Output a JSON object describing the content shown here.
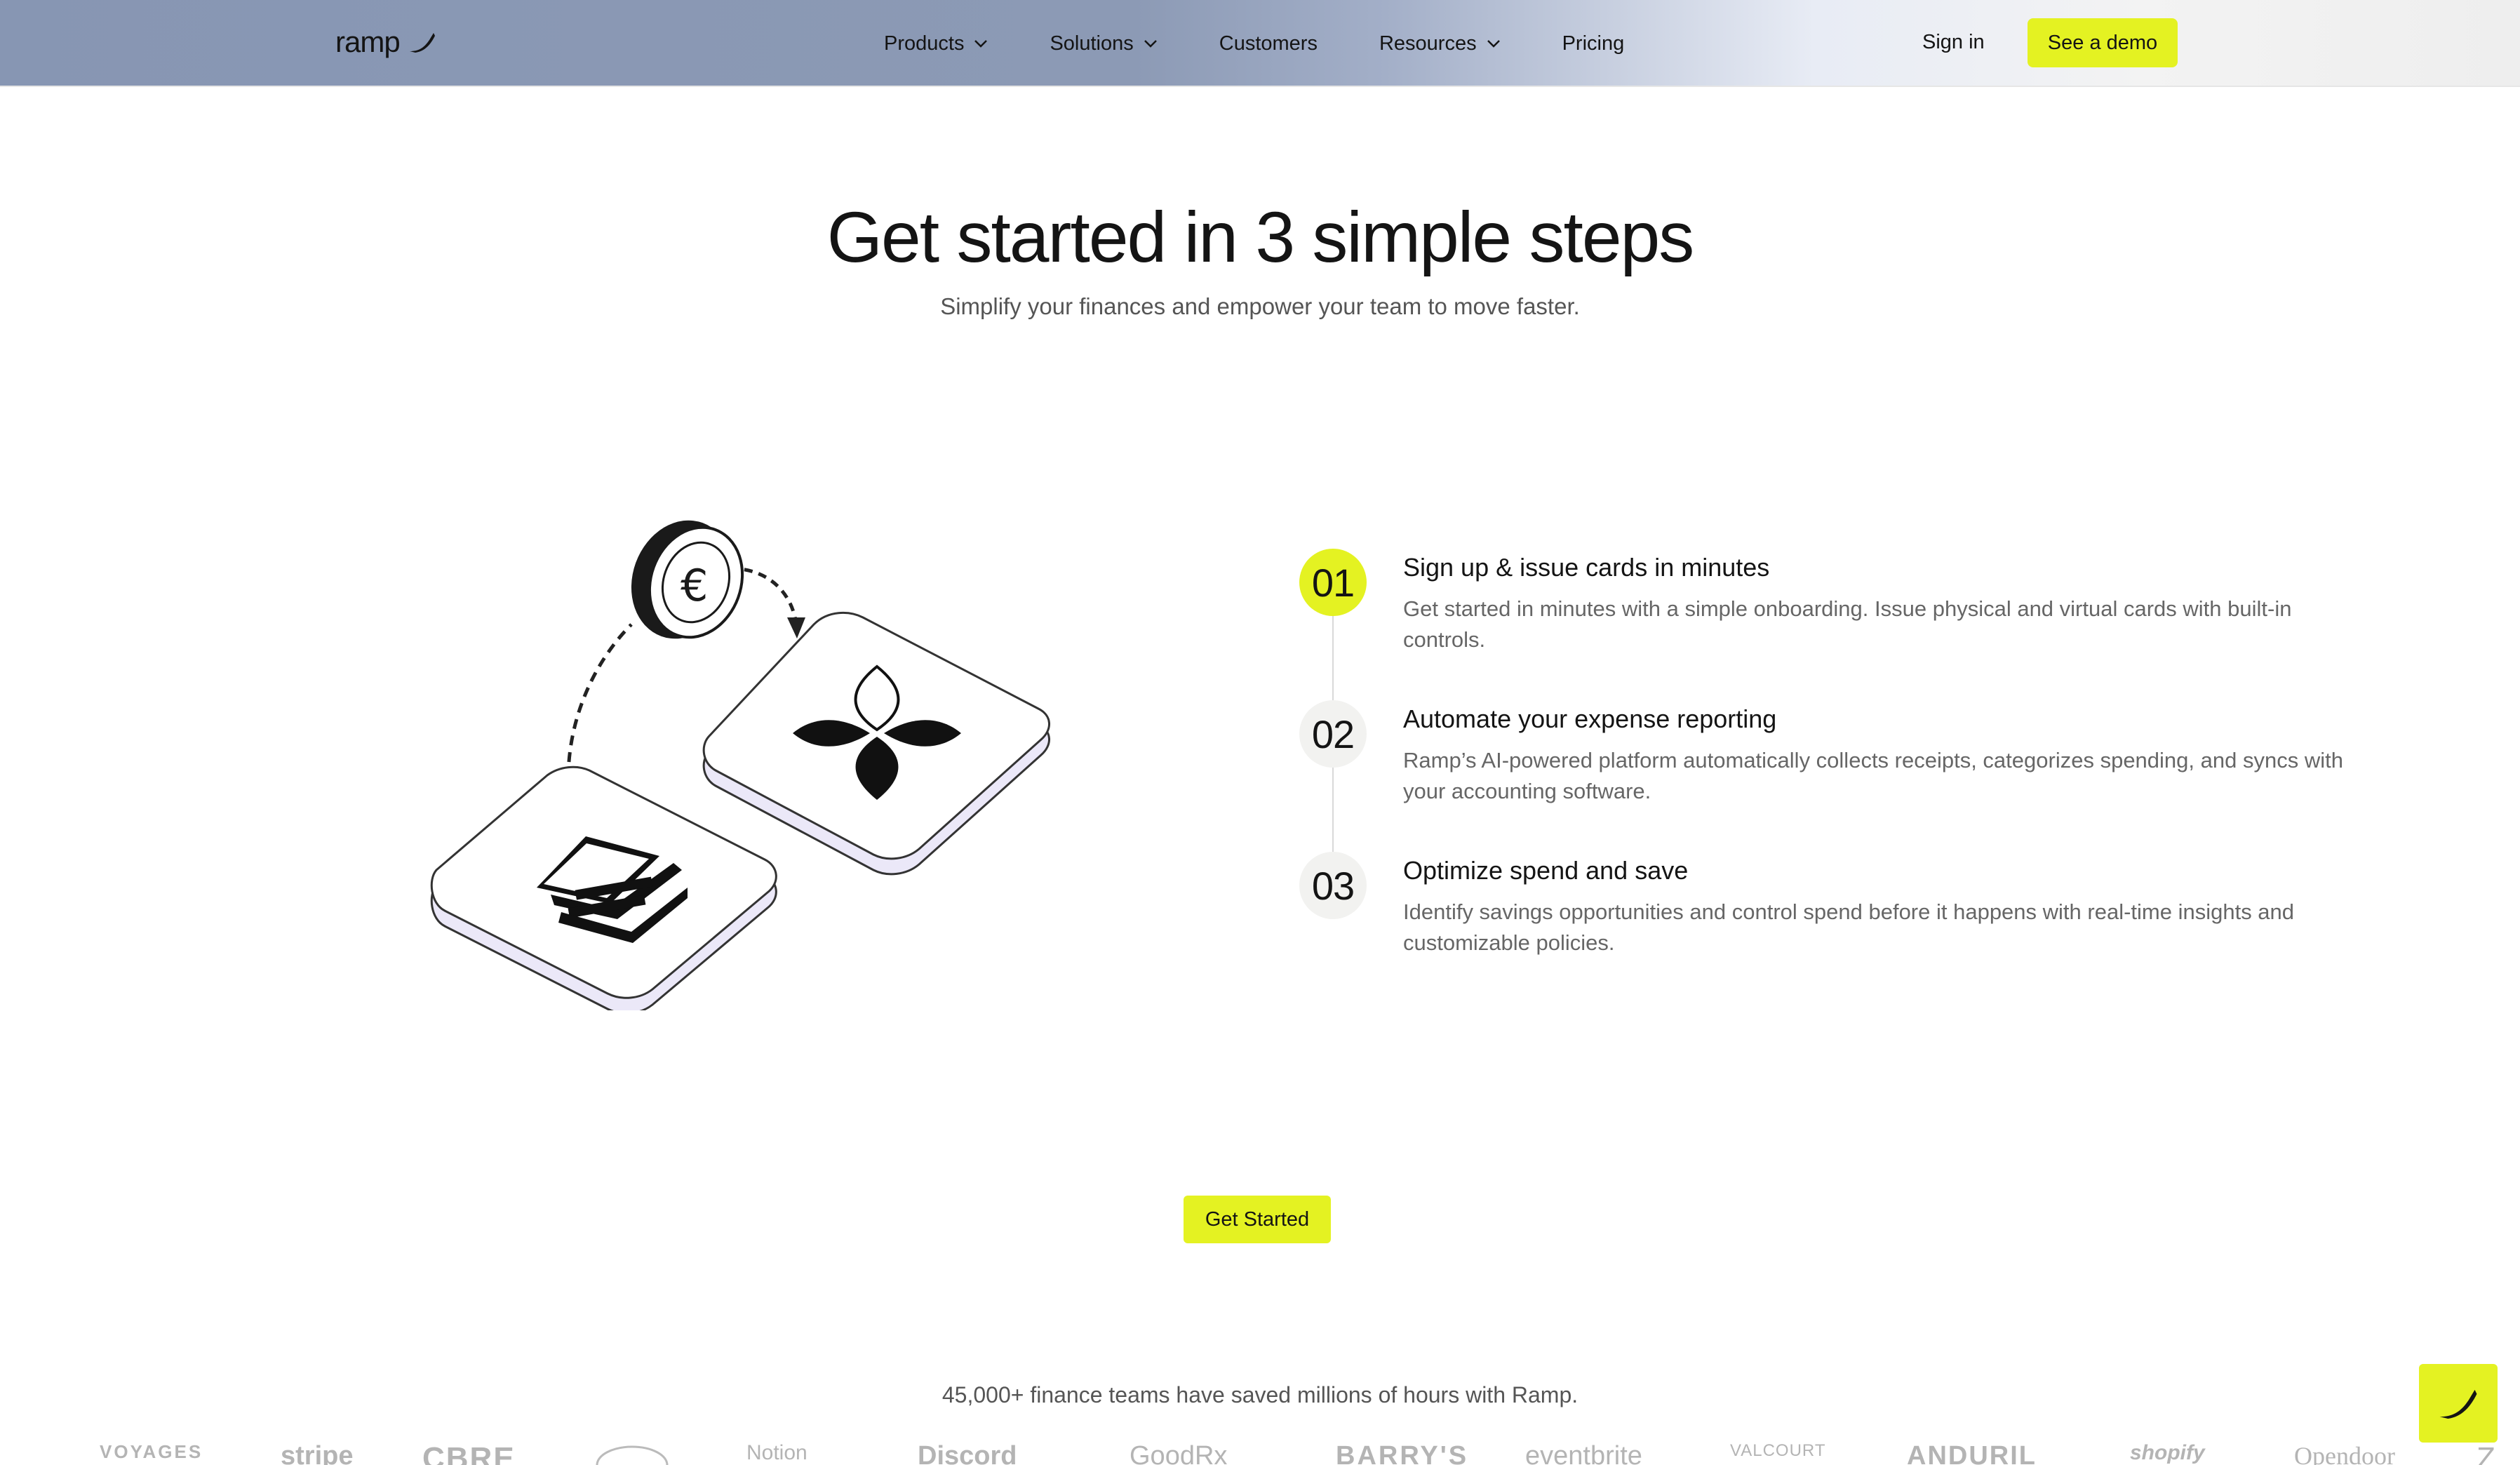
{
  "nav": {
    "logo_text": "ramp",
    "items": [
      {
        "label": "Products",
        "dropdown": true
      },
      {
        "label": "Solutions",
        "dropdown": true
      },
      {
        "label": "Customers",
        "dropdown": false
      },
      {
        "label": "Resources",
        "dropdown": true
      },
      {
        "label": "Pricing",
        "dropdown": false
      }
    ],
    "sign_in": "Sign in",
    "demo": "See a demo"
  },
  "hero": {
    "title": "Get started in 3 simple steps",
    "subtitle": "Simplify your finances and empower your team to move faster."
  },
  "steps": [
    {
      "num": "01",
      "title": "Sign up & issue cards in minutes",
      "desc": "Get started in minutes with a simple onboarding. Issue physical and virtual cards with built-in controls."
    },
    {
      "num": "02",
      "title": "Automate your expense reporting",
      "desc": "Ramp’s AI-powered platform automatically collects receipts, categorizes spending, and syncs with your accounting software."
    },
    {
      "num": "03",
      "title": "Optimize spend and save",
      "desc": "Identify savings opportunities and control spend before it happens with real-time insights and customizable policies."
    }
  ],
  "cta": "Get Started",
  "social_proof": "45,000+ finance teams have saved millions of hours with Ramp.",
  "brand_logos": [
    "VOYAGES",
    "stripe",
    "CBRE",
    "",
    "Notion",
    "Discord",
    "GoodRx",
    "BARRY'S",
    "eventbrite",
    "VALCOURT",
    "ANDURIL",
    "shopify",
    "Opendoor",
    "Z"
  ],
  "colors": {
    "accent": "#e4f222",
    "text": "#141414",
    "muted": "#666666"
  }
}
